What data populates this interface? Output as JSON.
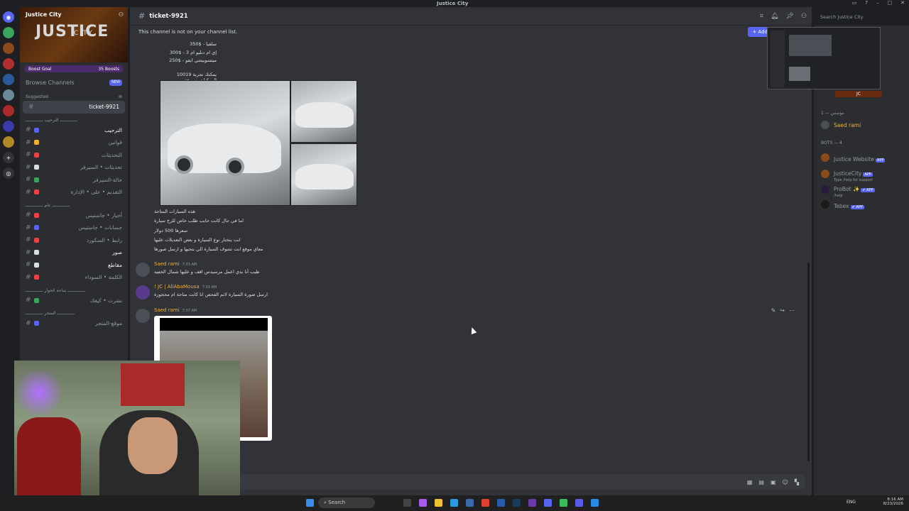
{
  "window": {
    "title": "Justice City"
  },
  "server": {
    "name": "Justice City",
    "logo_text": "JUSTICE",
    "logo_sub": "CITY",
    "boost_goal": "Boost Goal",
    "boosts": "35 Boosts",
    "browse_channels": "Browse Channels",
    "new_badge": "NEW",
    "suggested": "Suggested"
  },
  "channels": [
    {
      "name": "ticket-9921",
      "active": true
    },
    {
      "cat": "ــــــــــــــ الترحيب ــــــــــــــ"
    },
    {
      "name": "الترحيب",
      "color": "#5865f2",
      "bold": true
    },
    {
      "name": "قوانين",
      "color": "#f0b232"
    },
    {
      "name": "التحديثات",
      "color": "#ed4245"
    },
    {
      "name": "تحديثات • السيرفر",
      "color": "#dbdee1"
    },
    {
      "name": "حالة-السيرفر",
      "color": "#3ba55d"
    },
    {
      "name": "التقديم • على • الإدارة",
      "color": "#ed4245"
    },
    {
      "cat": "ــــــــــــــ عام ــــــــــــــ"
    },
    {
      "name": "أخبار • جاستيس",
      "color": "#ed4245"
    },
    {
      "name": "حسابات • جاستيس",
      "color": "#5865f2"
    },
    {
      "name": "رابط • السكورد",
      "color": "#ed4245"
    },
    {
      "name": "صور",
      "color": "#dbdee1",
      "bold": true
    },
    {
      "name": "مقاطع",
      "color": "#dbdee1",
      "bold": true
    },
    {
      "name": "الكلمة • السوداء",
      "color": "#ed4245"
    },
    {
      "cat": "ــــــــــــــ ساحة الحوار ــــــــــــــ"
    },
    {
      "name": "نشرت • كيفك",
      "color": "#3ba55d"
    },
    {
      "cat": "ــــــــــــــ المتجر ــــــــــــــ"
    },
    {
      "name": "موقع-المتجر",
      "color": "#5865f2"
    }
  ],
  "chat": {
    "channel": "ticket-9921",
    "notice": "This channel is not on your channel list.",
    "join_button": "+ Add",
    "price_lines": [
      "سلفيا - $350",
      "إي ام دبليو ام 3 - $300",
      "ميتسوبيشي ايفو - $250"
    ],
    "numbered_line": "10019 يمكنك تجربة المركبات بسرعة",
    "info_lines": [
      "هذه السيارات المتاحة",
      "اما في حال كانت حابب طلب خاص للرخ سيارة",
      "سعرها 500 دولار",
      "انت بتختار نوع السيارة و بعض التعديلات عليها",
      "معاي موقع انت تشوف السيارة الي بتحبها و ارسل صورها"
    ],
    "messages": [
      {
        "author": "Saed rami",
        "time": "7:33 AM",
        "text": "طيب أنا بدي اعمل مرسيدس اقف و عليها شمال الخفيه"
      },
      {
        "author": "! JC | AliAbaMousa",
        "time": "7:33 AM",
        "text": "ارسل صورة السيارة لاتم الفحص انا كانت متاحة ام محجوزة"
      },
      {
        "author": "Saed rami",
        "time": "7:37 AM",
        "text": ""
      }
    ]
  },
  "header": {
    "search_placeholder": "Search Justice City"
  },
  "members": {
    "top_user": "JC",
    "group_online": "مؤسس — 1",
    "owner": "Saed rami",
    "bots_group": "BOTS — 4",
    "bots": [
      {
        "name": "Justice Website",
        "badge": "APP",
        "status": ""
      },
      {
        "name": "JusticeCity",
        "badge": "APP",
        "status": "Type /help for support"
      },
      {
        "name": "ProBot ✨",
        "badge": "✔ APP",
        "status": "/help"
      },
      {
        "name": "Tebex",
        "badge": "✔ APP",
        "status": ""
      }
    ]
  },
  "taskbar": {
    "search": "Search",
    "lang": "ENG",
    "time": "8:16 AM",
    "date": "8/23/2026"
  },
  "colors": {
    "accent": "#5865f2",
    "username": "#f0b232",
    "bg": "#313338"
  }
}
